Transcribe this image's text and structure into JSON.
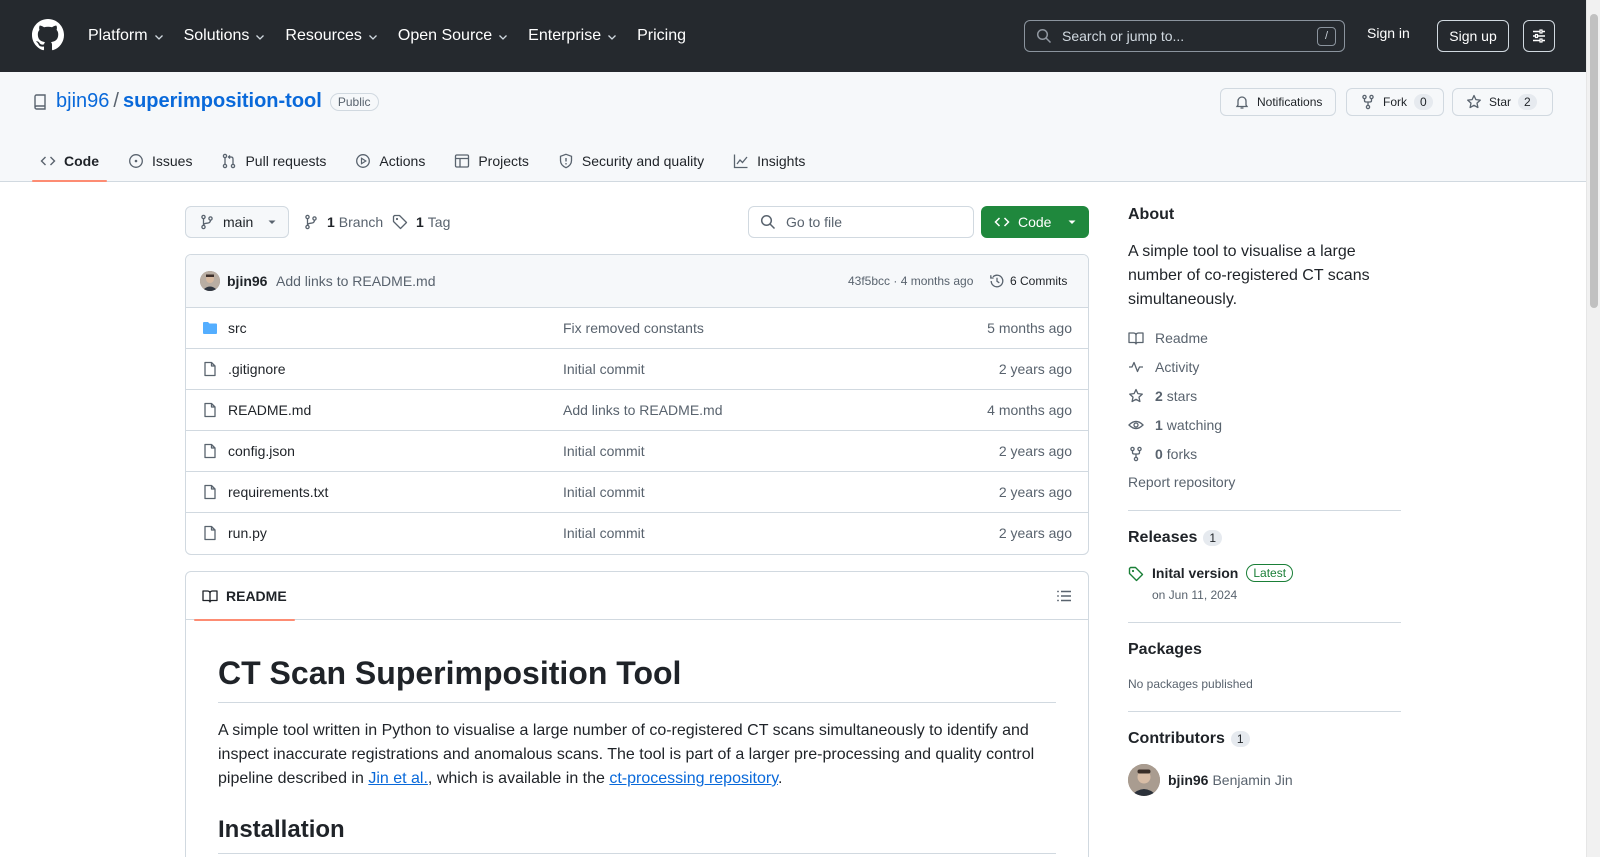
{
  "header": {
    "nav": [
      "Platform",
      "Solutions",
      "Resources",
      "Open Source",
      "Enterprise",
      "Pricing"
    ],
    "search_placeholder": "Search or jump to...",
    "search_shortcut": "/",
    "sign_in": "Sign in",
    "sign_up": "Sign up"
  },
  "repo": {
    "owner": "bjin96",
    "separator": "/",
    "name": "superimposition-tool",
    "visibility": "Public",
    "notifications_label": "Notifications",
    "fork_label": "Fork",
    "fork_count": "0",
    "star_label": "Star",
    "star_count": "2"
  },
  "tabs": [
    "Code",
    "Issues",
    "Pull requests",
    "Actions",
    "Projects",
    "Security and quality",
    "Insights"
  ],
  "branchbar": {
    "branch": "main",
    "branch_count": "1",
    "branch_label": "Branch",
    "tag_count": "1",
    "tag_label": "Tag",
    "goto_placeholder": "Go to file",
    "code_button": "Code"
  },
  "latest_commit": {
    "author": "bjin96",
    "message": "Add links to README.md",
    "hash_age": "43f5bcc · 4 months ago",
    "commits": "6 Commits"
  },
  "files": [
    {
      "name": "src",
      "type": "folder",
      "message": "Fix removed constants",
      "age": "5 months ago"
    },
    {
      "name": ".gitignore",
      "type": "file",
      "message": "Initial commit",
      "age": "2 years ago"
    },
    {
      "name": "README.md",
      "type": "file",
      "message": "Add links to README.md",
      "age": "4 months ago"
    },
    {
      "name": "config.json",
      "type": "file",
      "message": "Initial commit",
      "age": "2 years ago"
    },
    {
      "name": "requirements.txt",
      "type": "file",
      "message": "Initial commit",
      "age": "2 years ago"
    },
    {
      "name": "run.py",
      "type": "file",
      "message": "Initial commit",
      "age": "2 years ago"
    }
  ],
  "readme": {
    "tab": "README",
    "title": "CT Scan Superimposition Tool",
    "para_before": "A simple tool written in Python to visualise a large number of co-registered CT scans simultaneously to identify and inspect inaccurate registrations and anomalous scans. The tool is part of a larger pre-processing and quality control pipeline described in ",
    "link1": "Jin et al.",
    "para_mid": ", which is available in the ",
    "link2": "ct-processing repository",
    "para_end": ".",
    "h2": "Installation"
  },
  "sidebar": {
    "about_title": "About",
    "about_text": "A simple tool to visualise a large number of co-registered CT scans simultaneously.",
    "readme": "Readme",
    "activity": "Activity",
    "stars_count": "2",
    "stars_label": "stars",
    "watching_count": "1",
    "watching_label": "watching",
    "forks_count": "0",
    "forks_label": "forks",
    "report": "Report repository",
    "releases_title": "Releases",
    "releases_count": "1",
    "release_name": "Inital version",
    "release_badge": "Latest",
    "release_date": "on Jun 11, 2024",
    "packages_title": "Packages",
    "packages_text": "No packages published",
    "contributors_title": "Contributors",
    "contributors_count": "1",
    "contributor_login": "bjin96",
    "contributor_name": "Benjamin Jin"
  },
  "colors": {
    "header_bg": "#25292e",
    "link": "#0969da",
    "primary_button": "#1f883d",
    "tab_underline": "#fd8c73",
    "folder_icon": "#54aeff",
    "latest_badge": "#1a7f37"
  }
}
